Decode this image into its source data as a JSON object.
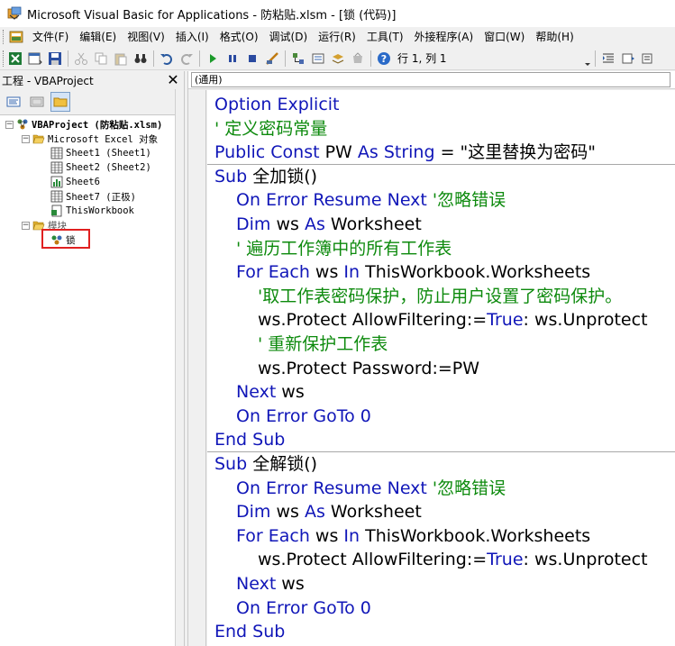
{
  "window": {
    "title": "Microsoft Visual Basic for Applications - 防粘贴.xlsm - [锁 (代码)]"
  },
  "menu": [
    {
      "label": "文件(F)"
    },
    {
      "label": "编辑(E)"
    },
    {
      "label": "视图(V)"
    },
    {
      "label": "插入(I)"
    },
    {
      "label": "格式(O)"
    },
    {
      "label": "调试(D)"
    },
    {
      "label": "运行(R)"
    },
    {
      "label": "工具(T)"
    },
    {
      "label": "外接程序(A)"
    },
    {
      "label": "窗口(W)"
    },
    {
      "label": "帮助(H)"
    }
  ],
  "toolbar": {
    "position": "行 1, 列 1"
  },
  "project": {
    "title": "工程 - VBAProject",
    "close": "✕",
    "root": "VBAProject (防粘贴.xlsm)",
    "excel_objects": "Microsoft Excel 对象",
    "sheets": [
      {
        "label": "Sheet1 (Sheet1)"
      },
      {
        "label": "Sheet2 (Sheet2)"
      },
      {
        "label": "Sheet6"
      },
      {
        "label": "Sheet7 (正极)"
      },
      {
        "label": "ThisWorkbook"
      }
    ],
    "modules": "模块",
    "module_item": "锁"
  },
  "code": {
    "proc_combo": "(通用)",
    "lines": [
      {
        "parts": [
          {
            "t": "Option Explicit",
            "c": "kw"
          }
        ]
      },
      {
        "parts": [
          {
            "t": "' 定义密码常量",
            "c": "cm"
          }
        ]
      },
      {
        "parts": [
          {
            "t": "Public Const",
            "c": "kw"
          },
          {
            "t": " PW ",
            "c": ""
          },
          {
            "t": "As String",
            "c": "kw"
          },
          {
            "t": " = \"这里替换为密码\"",
            "c": ""
          }
        ]
      },
      {
        "sep": true,
        "parts": [
          {
            "t": "Sub",
            "c": "kw"
          },
          {
            "t": " 全加锁()",
            "c": ""
          }
        ]
      },
      {
        "indent": 1,
        "parts": [
          {
            "t": "On Error Resume Next",
            "c": "kw"
          },
          {
            "t": "  '忽略错误",
            "c": "cm"
          }
        ]
      },
      {
        "indent": 1,
        "parts": [
          {
            "t": "Dim",
            "c": "kw"
          },
          {
            "t": " ws ",
            "c": ""
          },
          {
            "t": "As",
            "c": "kw"
          },
          {
            "t": " Worksheet",
            "c": ""
          }
        ]
      },
      {
        "indent": 1,
        "parts": [
          {
            "t": "' 遍历工作簿中的所有工作表",
            "c": "cm"
          }
        ]
      },
      {
        "indent": 1,
        "parts": [
          {
            "t": "For Each",
            "c": "kw"
          },
          {
            "t": " ws ",
            "c": ""
          },
          {
            "t": "In",
            "c": "kw"
          },
          {
            "t": " ThisWorkbook.Worksheets",
            "c": ""
          }
        ]
      },
      {
        "indent": 2,
        "parts": [
          {
            "t": "'取工作表密码保护，防止用户设置了密码保护。",
            "c": "cm"
          }
        ]
      },
      {
        "indent": 2,
        "parts": [
          {
            "t": "ws.Protect AllowFiltering:=",
            "c": ""
          },
          {
            "t": "True",
            "c": "kw"
          },
          {
            "t": ": ws.Unprotect",
            "c": ""
          }
        ]
      },
      {
        "indent": 2,
        "parts": [
          {
            "t": "' 重新保护工作表",
            "c": "cm"
          }
        ]
      },
      {
        "indent": 2,
        "parts": [
          {
            "t": "ws.Protect Password:=PW",
            "c": ""
          }
        ]
      },
      {
        "indent": 1,
        "parts": [
          {
            "t": "Next",
            "c": "kw"
          },
          {
            "t": " ws",
            "c": ""
          }
        ]
      },
      {
        "indent": 1,
        "parts": [
          {
            "t": "On Error GoTo 0",
            "c": "kw"
          }
        ]
      },
      {
        "parts": [
          {
            "t": "End Sub",
            "c": "kw"
          }
        ]
      },
      {
        "sep": true,
        "parts": [
          {
            "t": "Sub",
            "c": "kw"
          },
          {
            "t": " 全解锁()",
            "c": ""
          }
        ]
      },
      {
        "indent": 1,
        "parts": [
          {
            "t": "On Error Resume Next",
            "c": "kw"
          },
          {
            "t": "  '忽略错误",
            "c": "cm"
          }
        ]
      },
      {
        "indent": 1,
        "parts": [
          {
            "t": "Dim",
            "c": "kw"
          },
          {
            "t": " ws ",
            "c": ""
          },
          {
            "t": "As",
            "c": "kw"
          },
          {
            "t": " Worksheet",
            "c": ""
          }
        ]
      },
      {
        "indent": 1,
        "parts": [
          {
            "t": "For Each",
            "c": "kw"
          },
          {
            "t": " ws ",
            "c": ""
          },
          {
            "t": "In",
            "c": "kw"
          },
          {
            "t": " ThisWorkbook.Worksheets",
            "c": ""
          }
        ]
      },
      {
        "indent": 2,
        "parts": [
          {
            "t": "ws.Protect AllowFiltering:=",
            "c": ""
          },
          {
            "t": "True",
            "c": "kw"
          },
          {
            "t": ": ws.Unprotect",
            "c": ""
          }
        ]
      },
      {
        "indent": 1,
        "parts": [
          {
            "t": "Next",
            "c": "kw"
          },
          {
            "t": " ws",
            "c": ""
          }
        ]
      },
      {
        "indent": 1,
        "parts": [
          {
            "t": "On Error GoTo 0",
            "c": "kw"
          }
        ]
      },
      {
        "parts": [
          {
            "t": "End Sub",
            "c": "kw"
          }
        ]
      }
    ]
  },
  "colors": {
    "keyword": "#1016b8",
    "comment": "#0d8a0d",
    "highlight_box": "#e02020"
  }
}
